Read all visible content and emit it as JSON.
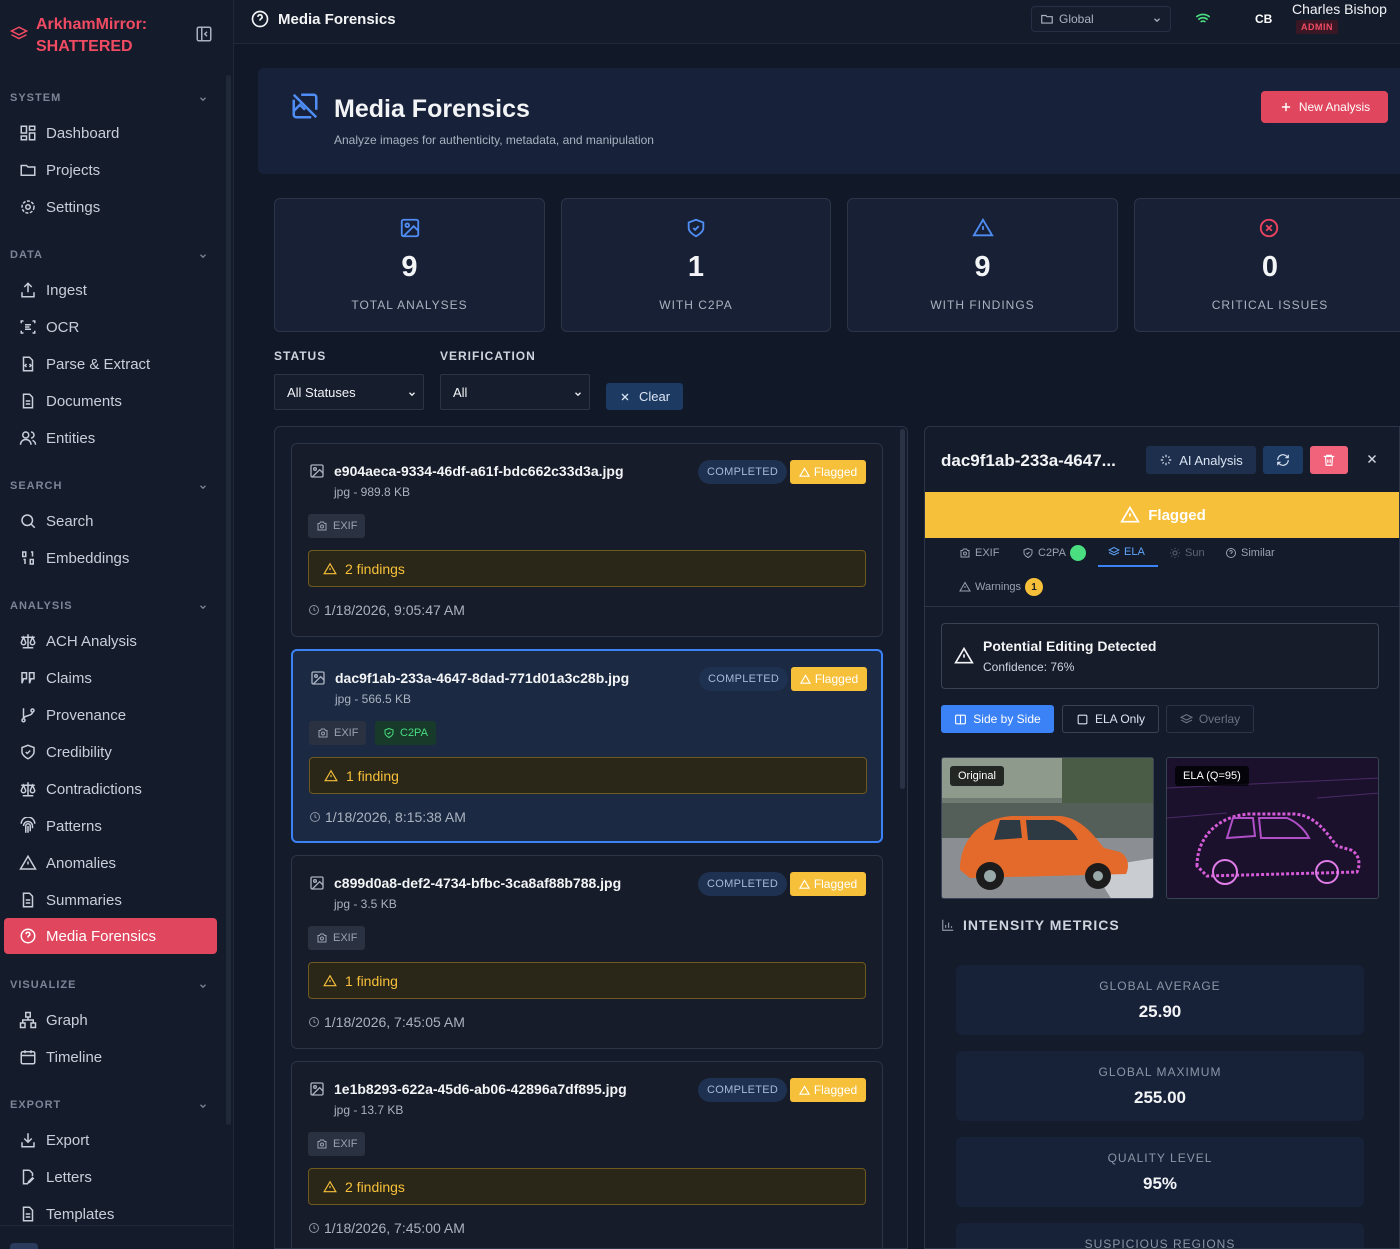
{
  "brand": {
    "line1": "ArkhamMirror:",
    "line2": "SHATTERED"
  },
  "sidebar": {
    "sections": [
      {
        "title": "SYSTEM",
        "items": [
          "Dashboard",
          "Projects",
          "Settings"
        ]
      },
      {
        "title": "DATA",
        "items": [
          "Ingest",
          "OCR",
          "Parse & Extract",
          "Documents",
          "Entities"
        ]
      },
      {
        "title": "SEARCH",
        "items": [
          "Search",
          "Embeddings"
        ]
      },
      {
        "title": "ANALYSIS",
        "items": [
          "ACH Analysis",
          "Claims",
          "Provenance",
          "Credibility",
          "Contradictions",
          "Patterns",
          "Anomalies",
          "Summaries",
          "Media Forensics"
        ]
      },
      {
        "title": "VISUALIZE",
        "items": [
          "Graph",
          "Timeline"
        ]
      },
      {
        "title": "EXPORT",
        "items": [
          "Export",
          "Letters",
          "Templates"
        ]
      }
    ],
    "active_item": "Media Forensics"
  },
  "topbar": {
    "title": "Media Forensics",
    "scope": "Global",
    "user_initials": "CB",
    "user_name": "Charles Bishop",
    "user_role": "ADMIN"
  },
  "header": {
    "title": "Media Forensics",
    "subtitle": "Analyze images for authenticity, metadata, and manipulation",
    "new_button": "New Analysis"
  },
  "stats": [
    {
      "value": "9",
      "label": "TOTAL ANALYSES",
      "icon": "image-icon",
      "color": "#4f8df5"
    },
    {
      "value": "1",
      "label": "WITH C2PA",
      "icon": "shield-check-icon",
      "color": "#4f8df5"
    },
    {
      "value": "9",
      "label": "WITH FINDINGS",
      "icon": "warning-icon",
      "color": "#4f8df5"
    },
    {
      "value": "0",
      "label": "CRITICAL ISSUES",
      "icon": "x-circle-icon",
      "color": "#ef4461"
    }
  ],
  "filters": {
    "status_label": "STATUS",
    "status_value": "All Statuses",
    "verification_label": "VERIFICATION",
    "verification_value": "All",
    "clear_label": "Clear"
  },
  "analyses": [
    {
      "filename": "e904aeca-9334-46df-a61f-bdc662c33d3a.jpg",
      "meta": "jpg - 989.8 KB",
      "status": "COMPLETED",
      "flag": "Flagged",
      "tags": [
        "EXIF"
      ],
      "findings": "2 findings",
      "time": "1/18/2026, 9:05:47 AM",
      "selected": false
    },
    {
      "filename": "dac9f1ab-233a-4647-8dad-771d01a3c28b.jpg",
      "meta": "jpg - 566.5 KB",
      "status": "COMPLETED",
      "flag": "Flagged",
      "tags": [
        "EXIF",
        "C2PA"
      ],
      "findings": "1 finding",
      "time": "1/18/2026, 8:15:38 AM",
      "selected": true
    },
    {
      "filename": "c899d0a8-def2-4734-bfbc-3ca8af88b788.jpg",
      "meta": "jpg - 3.5 KB",
      "status": "COMPLETED",
      "flag": "Flagged",
      "tags": [
        "EXIF"
      ],
      "findings": "1 finding",
      "time": "1/18/2026, 7:45:05 AM",
      "selected": false
    },
    {
      "filename": "1e1b8293-622a-45d6-ab06-42896a7df895.jpg",
      "meta": "jpg - 13.7 KB",
      "status": "COMPLETED",
      "flag": "Flagged",
      "tags": [
        "EXIF"
      ],
      "findings": "2 findings",
      "time": "1/18/2026, 7:45:00 AM",
      "selected": false
    }
  ],
  "detail": {
    "title": "dac9f1ab-233a-4647...",
    "ai_button": "AI Analysis",
    "flag_banner": "Flagged",
    "tabs": [
      "EXIF",
      "C2PA",
      "ELA",
      "Sun",
      "Similar",
      "Warnings"
    ],
    "active_tab": "ELA",
    "warnings_count": "1",
    "editing_title": "Potential Editing Detected",
    "editing_confidence": "Confidence: 76%",
    "view_buttons": [
      "Side by Side",
      "ELA Only",
      "Overlay"
    ],
    "original_label": "Original",
    "ela_label": "ELA (Q=95)",
    "metrics_heading": "INTENSITY METRICS",
    "metrics": [
      {
        "label": "GLOBAL AVERAGE",
        "value": "25.90"
      },
      {
        "label": "GLOBAL MAXIMUM",
        "value": "255.00"
      },
      {
        "label": "QUALITY LEVEL",
        "value": "95%"
      },
      {
        "label": "SUSPICIOUS REGIONS",
        "value": ""
      }
    ]
  }
}
